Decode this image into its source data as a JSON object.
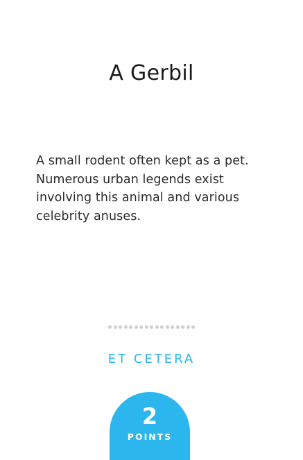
{
  "card": {
    "title": "A Gerbil",
    "description": "A small rodent often kept as a pet. Numerous urban legends exist involving this animal and various celebrity anuses.",
    "category": "ET CETERA",
    "points": {
      "value": "2",
      "label": "POINTS"
    }
  },
  "colors": {
    "accent": "#29b6ef",
    "text": "#1a1a1a",
    "dots": "#cfcfcf",
    "background": "#ffffff"
  }
}
